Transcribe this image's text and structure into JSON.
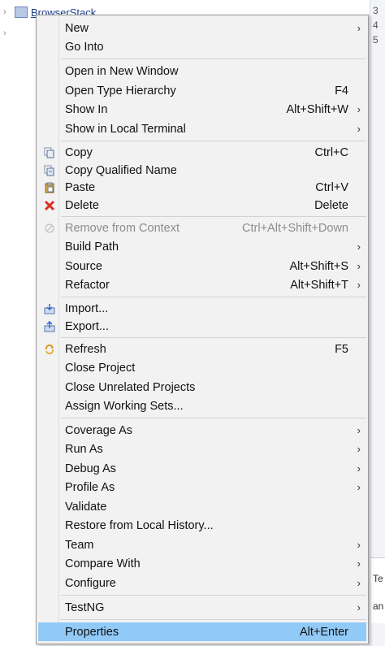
{
  "background": {
    "tree_row_label": "BrowserStack",
    "right_gutter_numbers": [
      "3",
      "4",
      "5"
    ],
    "lower_right_text": [
      "Te",
      "an"
    ]
  },
  "menu": {
    "items": [
      {
        "label": "New",
        "shortcut": "",
        "submenu": true,
        "icon": ""
      },
      {
        "label": "Go Into",
        "shortcut": "",
        "submenu": false,
        "icon": ""
      },
      {
        "label": "Open in New Window",
        "shortcut": "",
        "submenu": false,
        "icon": ""
      },
      {
        "label": "Open Type Hierarchy",
        "shortcut": "F4",
        "submenu": false,
        "icon": ""
      },
      {
        "label": "Show In",
        "shortcut": "Alt+Shift+W",
        "submenu": true,
        "icon": ""
      },
      {
        "label": "Show in Local Terminal",
        "shortcut": "",
        "submenu": true,
        "icon": ""
      },
      {
        "label": "Copy",
        "shortcut": "Ctrl+C",
        "submenu": false,
        "icon": "copy-icon"
      },
      {
        "label": "Copy Qualified Name",
        "shortcut": "",
        "submenu": false,
        "icon": "copy-qualified-name-icon"
      },
      {
        "label": "Paste",
        "shortcut": "Ctrl+V",
        "submenu": false,
        "icon": "paste-icon"
      },
      {
        "label": "Delete",
        "shortcut": "Delete",
        "submenu": false,
        "icon": "delete-icon"
      },
      {
        "label": "Remove from Context",
        "shortcut": "Ctrl+Alt+Shift+Down",
        "submenu": false,
        "icon": "remove-context-icon",
        "disabled": true
      },
      {
        "label": "Build Path",
        "shortcut": "",
        "submenu": true,
        "icon": ""
      },
      {
        "label": "Source",
        "shortcut": "Alt+Shift+S",
        "submenu": true,
        "icon": ""
      },
      {
        "label": "Refactor",
        "shortcut": "Alt+Shift+T",
        "submenu": true,
        "icon": ""
      },
      {
        "label": "Import...",
        "shortcut": "",
        "submenu": false,
        "icon": "import-icon"
      },
      {
        "label": "Export...",
        "shortcut": "",
        "submenu": false,
        "icon": "export-icon"
      },
      {
        "label": "Refresh",
        "shortcut": "F5",
        "submenu": false,
        "icon": "refresh-icon"
      },
      {
        "label": "Close Project",
        "shortcut": "",
        "submenu": false,
        "icon": ""
      },
      {
        "label": "Close Unrelated Projects",
        "shortcut": "",
        "submenu": false,
        "icon": ""
      },
      {
        "label": "Assign Working Sets...",
        "shortcut": "",
        "submenu": false,
        "icon": ""
      },
      {
        "label": "Coverage As",
        "shortcut": "",
        "submenu": true,
        "icon": ""
      },
      {
        "label": "Run As",
        "shortcut": "",
        "submenu": true,
        "icon": ""
      },
      {
        "label": "Debug As",
        "shortcut": "",
        "submenu": true,
        "icon": ""
      },
      {
        "label": "Profile As",
        "shortcut": "",
        "submenu": true,
        "icon": ""
      },
      {
        "label": "Validate",
        "shortcut": "",
        "submenu": false,
        "icon": ""
      },
      {
        "label": "Restore from Local History...",
        "shortcut": "",
        "submenu": false,
        "icon": ""
      },
      {
        "label": "Team",
        "shortcut": "",
        "submenu": true,
        "icon": ""
      },
      {
        "label": "Compare With",
        "shortcut": "",
        "submenu": true,
        "icon": ""
      },
      {
        "label": "Configure",
        "shortcut": "",
        "submenu": true,
        "icon": ""
      },
      {
        "label": "TestNG",
        "shortcut": "",
        "submenu": true,
        "icon": ""
      },
      {
        "label": "Properties",
        "shortcut": "Alt+Enter",
        "submenu": false,
        "icon": "",
        "selected": true
      }
    ],
    "submenu_arrow": "›",
    "colors": {
      "menu_background": "#f2f2f2",
      "selection": "#91c9f7",
      "disabled_text": "#8d8d8d",
      "delete_icon": "#d8322a"
    }
  }
}
